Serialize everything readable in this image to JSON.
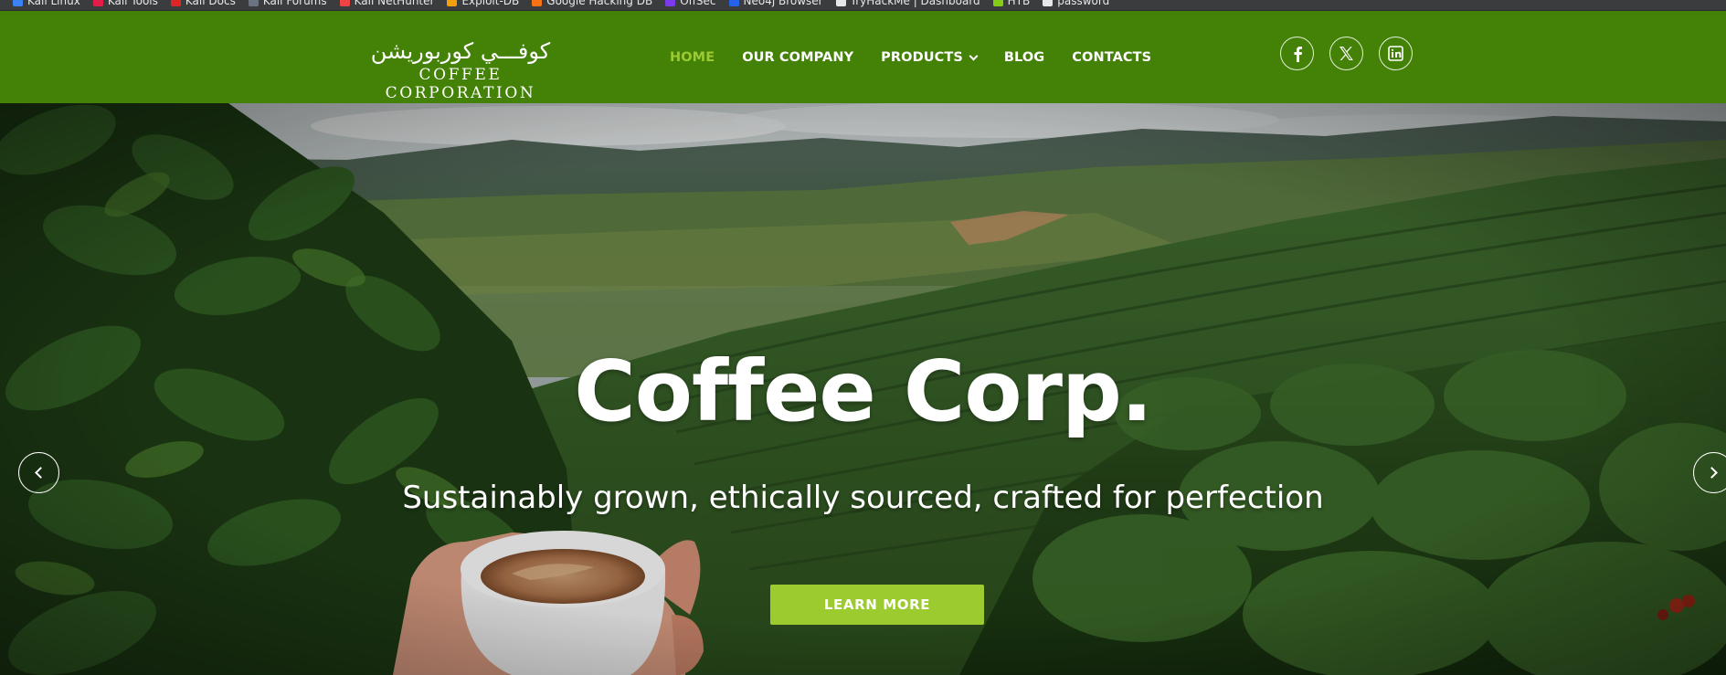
{
  "bookmarks": [
    {
      "label": "Kali Linux",
      "icon": "kali-icon",
      "color": "#3b82f6"
    },
    {
      "label": "Kali Tools",
      "icon": "kali-tools-icon",
      "color": "#e11d48"
    },
    {
      "label": "Kali Docs",
      "icon": "kali-docs-icon",
      "color": "#dc2626"
    },
    {
      "label": "Kali Forums",
      "icon": "kali-forums-icon",
      "color": "#6b7280"
    },
    {
      "label": "Kali NetHunter",
      "icon": "nethunter-icon",
      "color": "#ef4444"
    },
    {
      "label": "Exploit-DB",
      "icon": "exploit-db-icon",
      "color": "#f59e0b"
    },
    {
      "label": "Google Hacking DB",
      "icon": "ghdb-icon",
      "color": "#f97316"
    },
    {
      "label": "OffSec",
      "icon": "offsec-icon",
      "color": "#7c3aed"
    },
    {
      "label": "Neo4j Browser",
      "icon": "neo4j-icon",
      "color": "#2563eb"
    },
    {
      "label": "TryHackMe | Dashboard",
      "icon": "tryhackme-icon",
      "color": "#e5e7eb"
    },
    {
      "label": "HTB",
      "icon": "htb-icon",
      "color": "#84cc16"
    },
    {
      "label": "password",
      "icon": "globe-icon",
      "color": "#e5e7eb"
    }
  ],
  "header": {
    "logo_arabic": "كوفـــي كوربوريشن",
    "logo_english": "COFFEE CORPORATION",
    "nav": [
      {
        "label": "HOME",
        "active": true
      },
      {
        "label": "OUR COMPANY",
        "active": false
      },
      {
        "label": "PRODUCTS",
        "active": false,
        "dropdown": true
      },
      {
        "label": "BLOG",
        "active": false
      },
      {
        "label": "CONTACTS",
        "active": false
      }
    ],
    "socials": [
      "facebook-icon",
      "x-twitter-icon",
      "linkedin-icon"
    ]
  },
  "hero": {
    "title": "Coffee Corp.",
    "subtitle": "Sustainably grown, ethically sourced, crafted for perfection",
    "cta_label": "LEARN MORE"
  },
  "colors": {
    "header_bg": "#438107",
    "nav_active": "#9bcb31",
    "cta_bg": "#9ccb2f",
    "text": "#ffffff"
  }
}
